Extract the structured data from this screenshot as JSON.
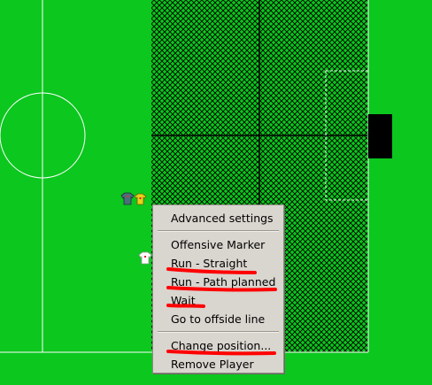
{
  "colors": {
    "pitch": "#0cc71e",
    "line": "#ffffff",
    "hatch": "#000000",
    "goal": "#000000",
    "menu_bg": "#d9d5cf",
    "annotation": "#ff0000"
  },
  "context_menu": {
    "advanced_settings": "Advanced settings",
    "offensive_marker": "Offensive Marker",
    "run_straight": "Run - Straight",
    "run_path_planned": "Run - Path planned",
    "wait": "Wait",
    "go_to_offside_line": "Go to offside line",
    "change_position": "Change position...",
    "remove_player": "Remove Player"
  },
  "icons": {
    "players": [
      "jersey-icon",
      "jersey-icon",
      "jersey-icon"
    ],
    "goal": "goal-rectangle"
  }
}
